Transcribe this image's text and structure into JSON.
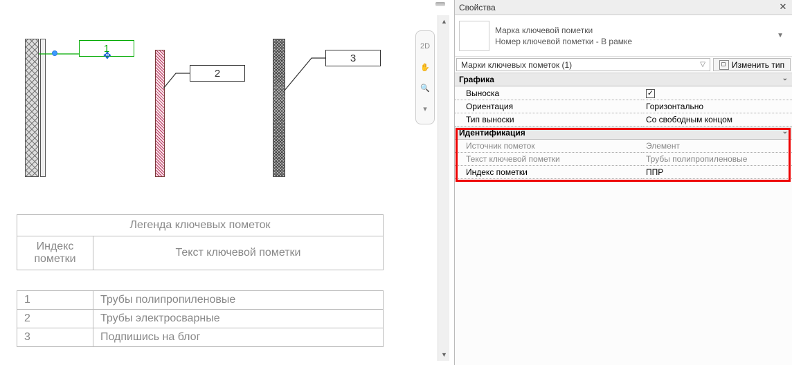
{
  "panel": {
    "title": "Свойства",
    "type_family": "Марка ключевой пометки",
    "type_name": "Номер ключевой пометки - В рамке",
    "instance_selector": "Марки ключевых пометок (1)",
    "edit_type": "Изменить тип"
  },
  "groups": {
    "graphics": {
      "header": "Графика",
      "rows": {
        "leader_label": "Выноска",
        "leader_checked": "✓",
        "orient_label": "Ориентация",
        "orient_value": "Горизонтально",
        "leader_type_label": "Тип выноски",
        "leader_type_value": "Со свободным концом"
      }
    },
    "ident": {
      "header": "Идентификация",
      "rows": {
        "src_label": "Источник пометок",
        "src_value": "Элемент",
        "text_label": "Текст ключевой пометки",
        "text_value": "Трубы полипропиленовые",
        "idx_label": "Индекс пометки",
        "idx_value": "ППР"
      }
    }
  },
  "tags": {
    "t1": "1",
    "t2": "2",
    "t3": "3"
  },
  "legend": {
    "title": "Легенда ключевых пометок",
    "col1": "Индекс пометки",
    "col2": "Текст ключевой пометки",
    "rows": [
      {
        "idx": "1",
        "txt": "Трубы полипропиленовые"
      },
      {
        "idx": "2",
        "txt": "Трубы электросварные"
      },
      {
        "idx": "3",
        "txt": "Подпишись на блог"
      }
    ]
  },
  "minitools": {
    "t2d": "2D"
  }
}
